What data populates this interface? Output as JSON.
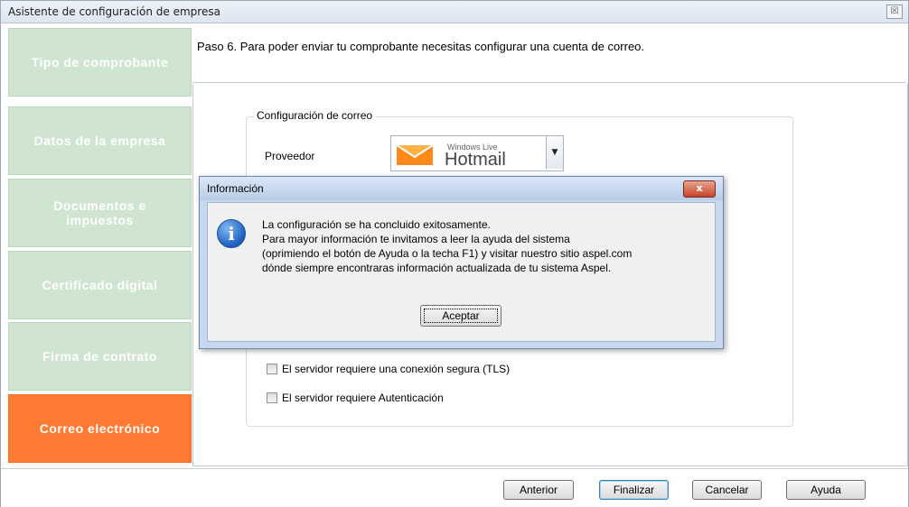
{
  "window": {
    "title": "Asistente de configuración de empresa",
    "close_label": "☒"
  },
  "sidebar": {
    "items": [
      {
        "label": "Tipo de comprobante"
      },
      {
        "label": "Datos de la empresa"
      },
      {
        "label": "Documentos e impuestos"
      },
      {
        "label": "Certificado digital"
      },
      {
        "label": "Firma de contrato"
      },
      {
        "label": "Correo electrónico"
      }
    ],
    "active_index": 5
  },
  "header": {
    "text": "Paso 6. Para poder enviar tu comprobante necesitas configurar una cuenta de correo."
  },
  "mail_config": {
    "group_label": "Configuración de correo",
    "provider_label": "Proveedor",
    "provider_logo_top": "Windows Live",
    "provider_logo_main": "Hotmail",
    "tls_label": "El servidor requiere una conexión segura (TLS)",
    "tls_checked": false,
    "auth_label": "El servidor requiere Autenticación",
    "auth_checked": false
  },
  "buttons": {
    "previous": "Anterior",
    "finish": "Finalizar",
    "cancel": "Cancelar",
    "help": "Ayuda"
  },
  "dialog": {
    "title": "Información",
    "close_label": "x",
    "icon": "info-icon",
    "lines": [
      "La configuración se ha concluido exitosamente.",
      "Para mayor información te invitamos a leer la ayuda del sistema",
      "(oprimiendo el botón de Ayuda o la techa F1) y visitar nuestro sitio aspel.com",
      "dónde siempre encontraras información actualizada de tu sistema Aspel."
    ],
    "ok_label": "Aceptar"
  },
  "colors": {
    "active_step": "#ff7a33",
    "inactive_step": "#cfe5cf",
    "dialog_frame": "#c7d8ee"
  }
}
